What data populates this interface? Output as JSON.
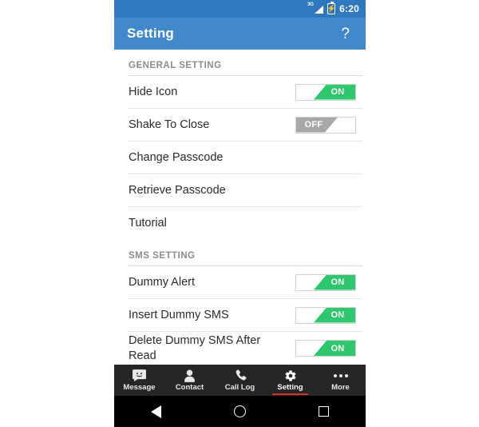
{
  "status_bar": {
    "network": "3G",
    "signal_icon": "signal-bars-icon",
    "battery_icon": "battery-charging-icon",
    "time": "6:20"
  },
  "toolbar": {
    "title": "Setting",
    "help_label": "?",
    "background": "#4289cc"
  },
  "colors": {
    "toolbar_blue": "#4289cc",
    "statusbar_blue": "#2f78bd",
    "toggle_on_green": "#2fc76d",
    "toggle_off_gray": "#a8a8a8",
    "tab_active_red": "#d93025",
    "tabbar_dark": "#262626"
  },
  "sections": [
    {
      "header": "GENERAL SETTING",
      "rows": [
        {
          "label": "Hide Icon",
          "toggle": "ON"
        },
        {
          "label": "Shake To Close",
          "toggle": "OFF"
        },
        {
          "label": "Change Passcode",
          "toggle": null
        },
        {
          "label": "Retrieve Passcode",
          "toggle": null
        },
        {
          "label": "Tutorial",
          "toggle": null
        }
      ]
    },
    {
      "header": "SMS SETTING",
      "rows": [
        {
          "label": "Dummy Alert",
          "toggle": "ON"
        },
        {
          "label": "Insert Dummy SMS",
          "toggle": "ON"
        },
        {
          "label": "Delete Dummy SMS After Read",
          "toggle": "ON"
        }
      ]
    }
  ],
  "tabbar": {
    "items": [
      {
        "label": "Message",
        "icon": "message-bubble-icon",
        "active": false
      },
      {
        "label": "Contact",
        "icon": "person-icon",
        "active": false
      },
      {
        "label": "Call Log",
        "icon": "phone-handset-icon",
        "active": false
      },
      {
        "label": "Setting",
        "icon": "gear-icon",
        "active": true
      },
      {
        "label": "More",
        "icon": "overflow-dots-icon",
        "active": false
      }
    ]
  },
  "navbar": {
    "back": "back-triangle-icon",
    "home": "home-circle-icon",
    "recents": "recents-square-icon"
  }
}
